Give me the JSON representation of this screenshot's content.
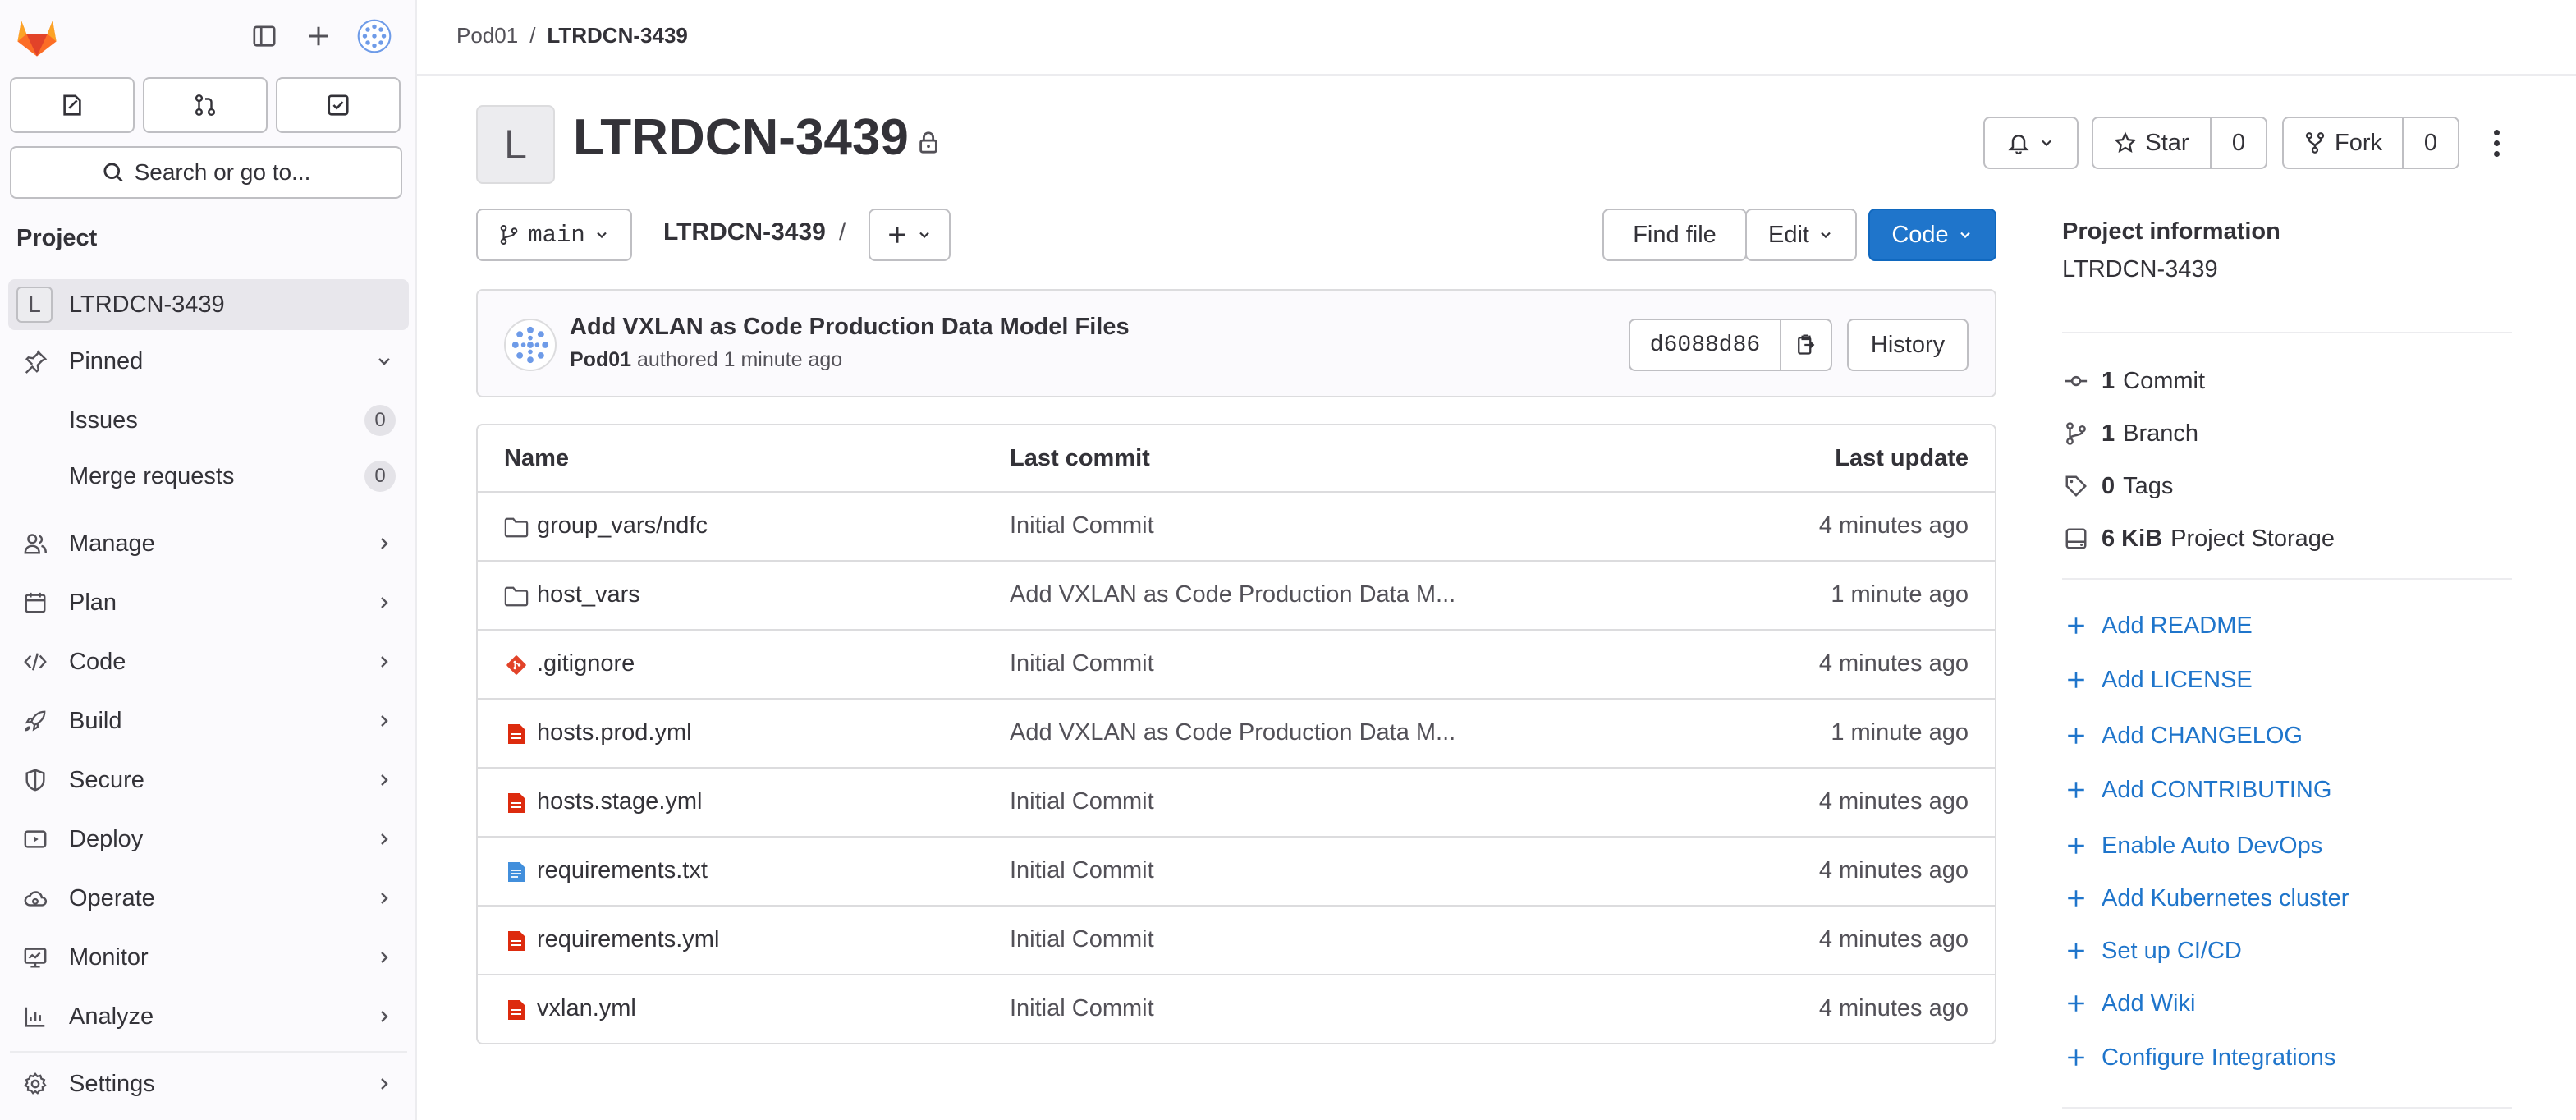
{
  "sidebar": {
    "section_title": "Project",
    "project": {
      "initial": "L",
      "name": "LTRDCN-3439"
    },
    "search_label": "Search or go to...",
    "pinned": {
      "label": "Pinned",
      "items": [
        {
          "label": "Issues",
          "count": "0"
        },
        {
          "label": "Merge requests",
          "count": "0"
        }
      ]
    },
    "nav": [
      {
        "label": "Manage",
        "icon": "users-icon"
      },
      {
        "label": "Plan",
        "icon": "planning-icon"
      },
      {
        "label": "Code",
        "icon": "code-icon"
      },
      {
        "label": "Build",
        "icon": "rocket-icon"
      },
      {
        "label": "Secure",
        "icon": "shield-icon"
      },
      {
        "label": "Deploy",
        "icon": "deploy-icon"
      },
      {
        "label": "Operate",
        "icon": "cloud-gear-icon"
      },
      {
        "label": "Monitor",
        "icon": "monitor-icon"
      },
      {
        "label": "Analyze",
        "icon": "chart-icon"
      },
      {
        "label": "Settings",
        "icon": "gear-icon"
      }
    ]
  },
  "breadcrumb": {
    "group": "Pod01",
    "separator": "/",
    "project": "LTRDCN-3439"
  },
  "header": {
    "initial": "L",
    "title": "LTRDCN-3439",
    "star_label": "Star",
    "star_count": "0",
    "fork_label": "Fork",
    "fork_count": "0"
  },
  "repo": {
    "branch": "main",
    "path": "LTRDCN-3439",
    "path_sep": "/",
    "find_file": "Find file",
    "edit": "Edit",
    "code": "Code"
  },
  "last_commit": {
    "title": "Add VXLAN as Code Production Data Model Files",
    "author": "Pod01",
    "meta": "authored 1 minute ago",
    "sha": "d6088d86",
    "history": "History"
  },
  "files": {
    "headers": {
      "name": "Name",
      "commit": "Last commit",
      "update": "Last update"
    },
    "rows": [
      {
        "name": "group_vars/ndfc",
        "type": "folder",
        "commit": "Initial Commit",
        "updated": "4 minutes ago"
      },
      {
        "name": "host_vars",
        "type": "folder",
        "commit": "Add VXLAN as Code Production Data M...",
        "updated": "1 minute ago"
      },
      {
        "name": ".gitignore",
        "type": "git",
        "commit": "Initial Commit",
        "updated": "4 minutes ago"
      },
      {
        "name": "hosts.prod.yml",
        "type": "yaml",
        "commit": "Add VXLAN as Code Production Data M...",
        "updated": "1 minute ago"
      },
      {
        "name": "hosts.stage.yml",
        "type": "yaml",
        "commit": "Initial Commit",
        "updated": "4 minutes ago"
      },
      {
        "name": "requirements.txt",
        "type": "text",
        "commit": "Initial Commit",
        "updated": "4 minutes ago"
      },
      {
        "name": "requirements.yml",
        "type": "yaml",
        "commit": "Initial Commit",
        "updated": "4 minutes ago"
      },
      {
        "name": "vxlan.yml",
        "type": "yaml",
        "commit": "Initial Commit",
        "updated": "4 minutes ago"
      }
    ]
  },
  "project_info": {
    "title": "Project information",
    "name": "LTRDCN-3439",
    "stats": [
      {
        "count": "1",
        "label": "Commit",
        "icon": "commit-icon"
      },
      {
        "count": "1",
        "label": "Branch",
        "icon": "branch-icon"
      },
      {
        "count": "0",
        "label": "Tags",
        "icon": "tag-icon"
      },
      {
        "count": "6 KiB",
        "label": "Project Storage",
        "icon": "storage-icon"
      }
    ],
    "actions": [
      "Add README",
      "Add LICENSE",
      "Add CHANGELOG",
      "Add CONTRIBUTING",
      "Enable Auto DevOps",
      "Add Kubernetes cluster",
      "Set up CI/CD",
      "Add Wiki",
      "Configure Integrations"
    ]
  },
  "colors": {
    "primary": "#1f75cb",
    "link": "#1f75cb",
    "file_yaml": "#dd2b0e",
    "file_text": "#428fdc",
    "git": "#e24329"
  }
}
